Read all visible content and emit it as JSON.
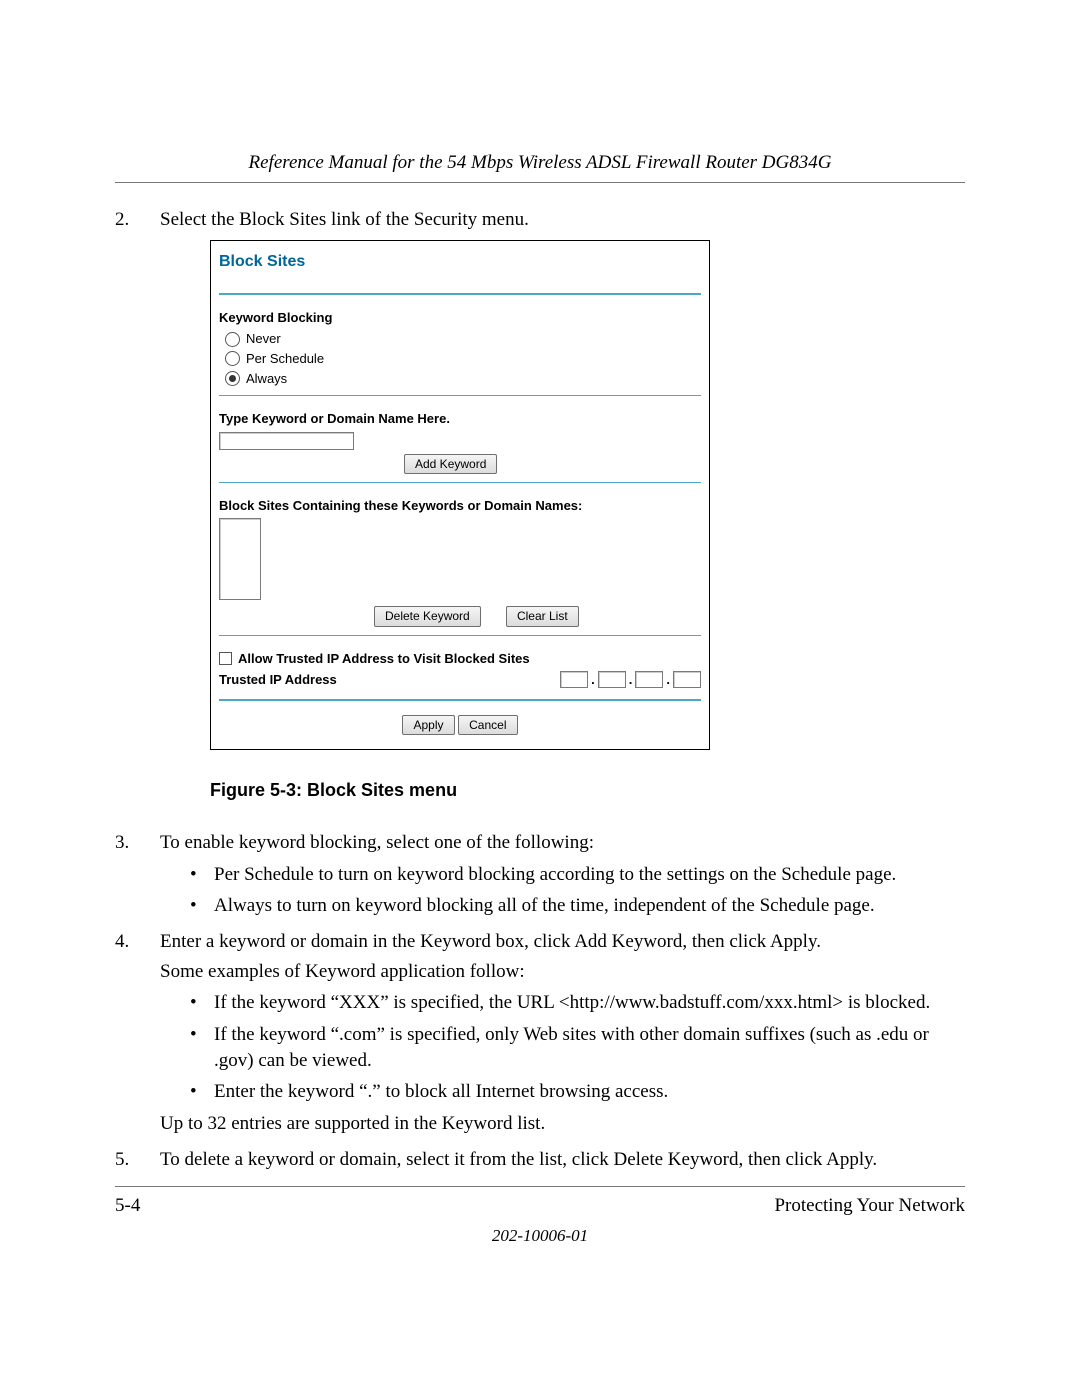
{
  "header": {
    "running_title": "Reference Manual for the 54 Mbps Wireless ADSL Firewall Router DG834G"
  },
  "steps": {
    "s2": {
      "num": "2.",
      "text": "Select the Block Sites link of the Security menu."
    },
    "s3": {
      "num": "3.",
      "text": "To enable keyword blocking, select one of the following:",
      "b1": "Per Schedule to turn on keyword blocking according to the settings on the Schedule page.",
      "b2": "Always to turn on keyword blocking all of the time, independent of the Schedule page."
    },
    "s4": {
      "num": "4.",
      "line1": "Enter a keyword or domain in the Keyword box, click Add Keyword, then click Apply.",
      "line2": "Some examples of Keyword application follow:",
      "b1": "If the keyword “XXX” is specified, the URL <http://www.badstuff.com/xxx.html> is blocked.",
      "b2": "If the keyword “.com” is specified, only Web sites with other domain suffixes (such as .edu or .gov) can be viewed.",
      "b3": "Enter the keyword “.” to block all Internet browsing access.",
      "tail": "Up to 32 entries are supported in the Keyword list."
    },
    "s5": {
      "num": "5.",
      "text": "To delete a keyword or domain, select it from the list, click Delete Keyword, then click Apply."
    }
  },
  "figure_caption": "Figure 5-3:  Block Sites menu",
  "ui": {
    "title": "Block Sites",
    "keyword_blocking": {
      "heading": "Keyword Blocking",
      "never": "Never",
      "per_schedule": "Per Schedule",
      "always": "Always",
      "selected": "always"
    },
    "type_keyword_label": "Type Keyword or Domain Name Here.",
    "add_keyword": "Add Keyword",
    "list_label": "Block Sites Containing these Keywords or Domain Names:",
    "delete_keyword": "Delete Keyword",
    "clear_list": "Clear List",
    "allow_trusted": "Allow Trusted IP Address to Visit Blocked Sites",
    "trusted_label": "Trusted IP Address",
    "apply": "Apply",
    "cancel": "Cancel",
    "ip_dot": "."
  },
  "footer": {
    "page": "5-4",
    "section": "Protecting Your Network",
    "docnum": "202-10006-01"
  }
}
